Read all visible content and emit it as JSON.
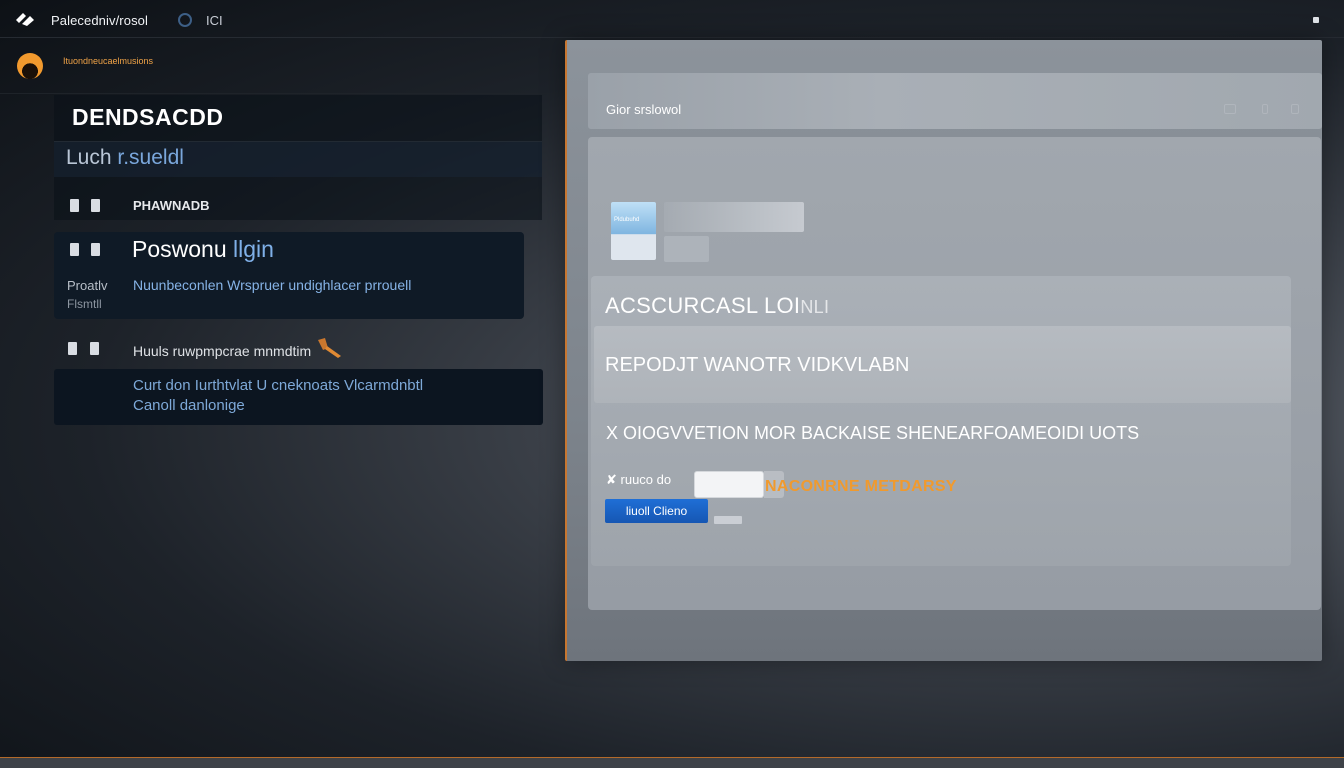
{
  "topbar": {
    "app_title": "Palecedniv/rosol",
    "tab_label": "ICI"
  },
  "sidebar": {
    "user_name": "Ituondneucaelmusions",
    "section_title": "DENDSACDD",
    "search": {
      "text": "Luch ",
      "accent": "r.sueldl"
    },
    "items": [
      {
        "label": "PHAWNADB"
      },
      {
        "label": "Poswonu ",
        "accent": "llgin",
        "side_line1": "Proatlv",
        "side_line2": "Flsmtll",
        "description": "Nuunbeconlen Wrspruer undighlacer prrouell"
      },
      {
        "label": "Huuls  ruwpmpcrae mnmdtim"
      }
    ],
    "info": {
      "line1": "Curt don Iurthtvlat U cneknoats Vlcarmdnbtl",
      "line2": "Canoll danlonige"
    }
  },
  "window": {
    "title": "Gior srslowol",
    "thumb_text": "Pldubuhd",
    "card_title": "ACSCURCASL LOI",
    "card_title_tail": "NLI",
    "subcard_title": "REPODJT WANOTR VIDKVLABN",
    "line": "X OIOGVVETION MOR BACKAISE SHENEARFOAMEOIDI UOTS",
    "field_label": "✘ ruuco do",
    "orange_link": "NACONRNE METDARSY",
    "primary_button": "liuoll Clieno"
  },
  "colors": {
    "accent_orange": "#f09a2e",
    "accent_blue": "#1f6fd6",
    "link_blue": "#7ea9d8"
  }
}
